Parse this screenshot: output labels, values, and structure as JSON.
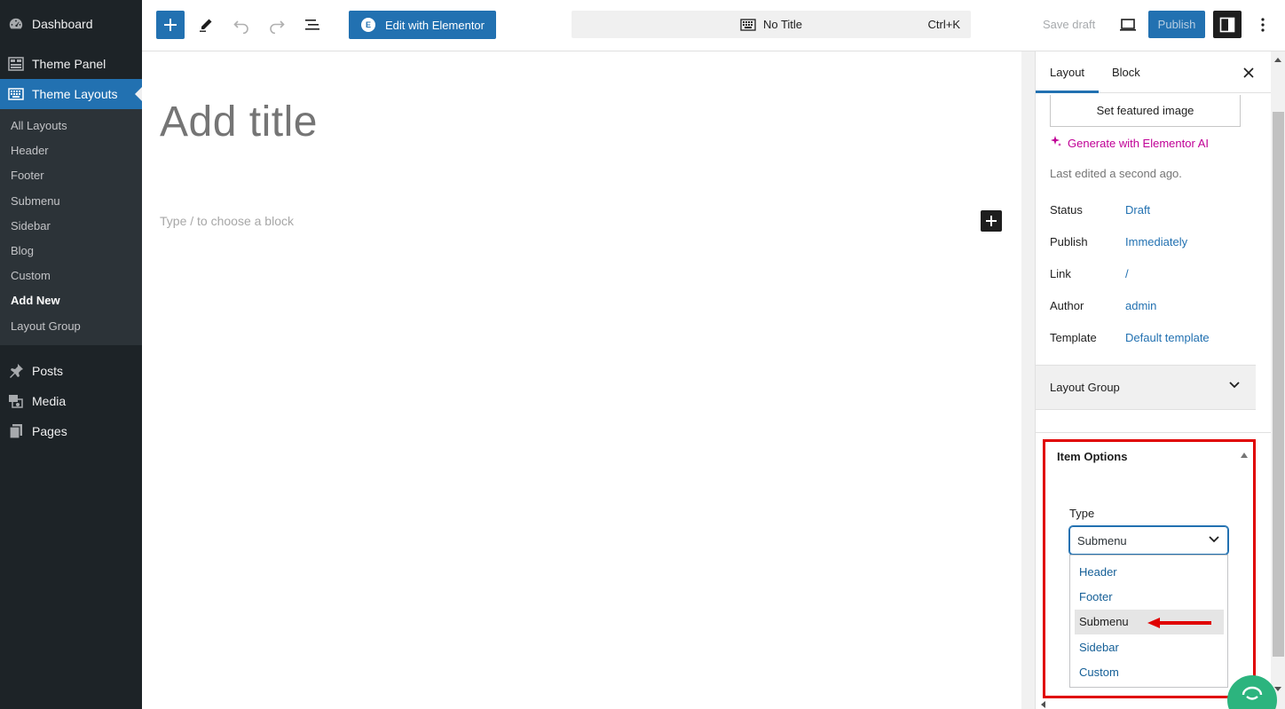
{
  "sidebar": {
    "top_items": [
      {
        "label": "Dashboard",
        "icon": "dashboard-icon"
      },
      {
        "label": "Theme Panel",
        "icon": "grid-icon"
      },
      {
        "label": "Theme Layouts",
        "icon": "keyboard-icon"
      }
    ],
    "submenu": [
      "All Layouts",
      "Header",
      "Footer",
      "Submenu",
      "Sidebar",
      "Blog",
      "Custom",
      "Add New",
      "Layout Group"
    ],
    "bottom_items": [
      {
        "label": "Posts",
        "icon": "pushpin-icon"
      },
      {
        "label": "Media",
        "icon": "media-icon"
      },
      {
        "label": "Pages",
        "icon": "pages-icon"
      }
    ]
  },
  "toolbar": {
    "elementor_label": "Edit with Elementor",
    "doc_title": "No Title",
    "shortcut": "Ctrl+K",
    "save_draft": "Save draft",
    "publish": "Publish"
  },
  "editor": {
    "title_placeholder": "Add title",
    "block_hint": "Type / to choose a block"
  },
  "settings": {
    "tabs": [
      "Layout",
      "Block"
    ],
    "featured_image": "Set featured image",
    "generate_ai": "Generate with Elementor AI",
    "last_edited": "Last edited a second ago.",
    "meta": [
      {
        "key": "Status",
        "value": "Draft"
      },
      {
        "key": "Publish",
        "value": "Immediately"
      },
      {
        "key": "Link",
        "value": "/"
      },
      {
        "key": "Author",
        "value": "admin"
      },
      {
        "key": "Template",
        "value": "Default template"
      }
    ],
    "layout_group": "Layout Group",
    "item_options": {
      "title": "Item Options",
      "type_label": "Type",
      "selected": "Submenu",
      "options": [
        "Header",
        "Footer",
        "Submenu",
        "Sidebar",
        "Custom"
      ]
    }
  },
  "colors": {
    "accent": "#2271b1",
    "sidebar_bg": "#1d2327",
    "highlight_border": "#e00000",
    "ai_link": "#c00096"
  }
}
